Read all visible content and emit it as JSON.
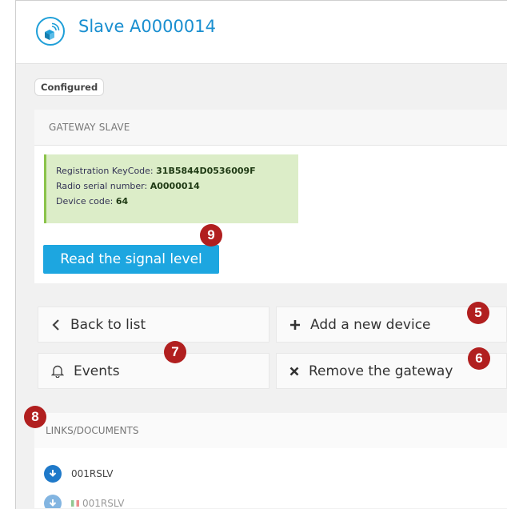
{
  "header": {
    "title": "Slave A0000014",
    "icon": "wireless-device-icon"
  },
  "status": {
    "badge": "Configured"
  },
  "gateway_panel": {
    "title": "GATEWAY SLAVE",
    "info": {
      "registration_label": "Registration KeyCode: ",
      "registration_value": "31B5844D0536009F",
      "serial_label": "Radio serial number: ",
      "serial_value": "A0000014",
      "device_code_label": "Device code: ",
      "device_code_value": "64"
    },
    "read_signal_button": "Read the signal level"
  },
  "actions": {
    "back_to_list": "Back to list",
    "add_device": "Add a new device",
    "events": "Events",
    "remove_gateway": "Remove the gateway"
  },
  "links": {
    "title": "LINKS/DOCUMENTS",
    "items": [
      {
        "label": "001RSLV"
      },
      {
        "label": "001RSLV"
      }
    ]
  },
  "callouts": {
    "c5": "5",
    "c6": "6",
    "c7": "7",
    "c8": "8",
    "c9": "9"
  },
  "colors": {
    "accent": "#1da6e0",
    "title": "#1a8fd0",
    "info_bg": "#dcedc8",
    "info_border": "#8bc34a",
    "callout": "#b11f1f"
  }
}
